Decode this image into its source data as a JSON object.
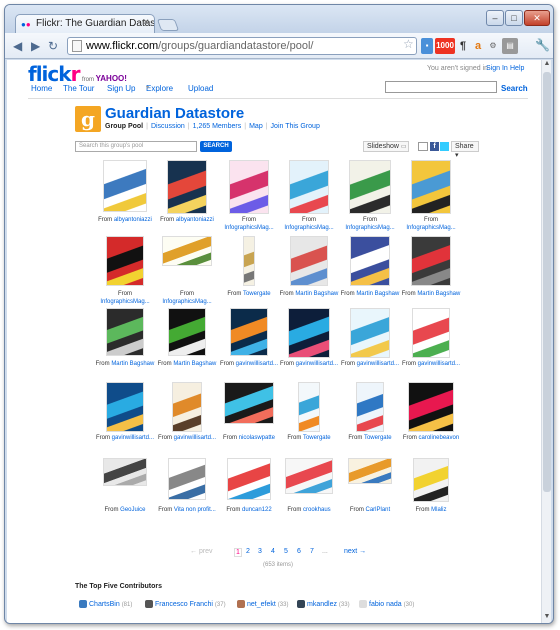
{
  "browser": {
    "tab_title": "Flickr: The Guardian Datastore",
    "url_host": "www.flickr.com",
    "url_path": "/groups/guardiandatastore/pool/",
    "ext_counter": "1000"
  },
  "header": {
    "logo_part1": "flick",
    "logo_part2": "r",
    "yahoo_prefix": "from",
    "yahoo": "YAHOO!",
    "signin_status": "You aren't signed in",
    "signin": "Sign In",
    "help": "Help",
    "search_button": "Search"
  },
  "nav": {
    "home": "Home",
    "tour": "The Tour",
    "signup": "Sign Up",
    "explore": "Explore",
    "upload": "Upload"
  },
  "group": {
    "title": "Guardian Datastore",
    "pool": "Group Pool",
    "discussion": "Discussion",
    "members": "1,265 Members",
    "map": "Map",
    "join": "Join This Group"
  },
  "pool_search": {
    "placeholder": "Search this group's pool",
    "button": "SEARCH"
  },
  "actions": {
    "slideshow": "Slideshow",
    "share": "Share"
  },
  "thumbs": [
    {
      "prefix": "From",
      "who": "albyantoniazzi",
      "colors": [
        "#ffffff",
        "#3d7abf",
        "#f0c93b"
      ]
    },
    {
      "prefix": "From",
      "who": "albyantoniazzi",
      "colors": [
        "#17324f",
        "#e4473a",
        "#f4d35e"
      ]
    },
    {
      "prefix": "From",
      "who": "InfographicsMag...",
      "colors": [
        "#fbe3ef",
        "#d6336c",
        "#6c5ce7"
      ]
    },
    {
      "prefix": "From",
      "who": "InfographicsMag...",
      "colors": [
        "#e3f2fb",
        "#3aa6d9",
        "#e8484f"
      ]
    },
    {
      "prefix": "From",
      "who": "InfographicsMag...",
      "colors": [
        "#f2f2e8",
        "#3a9a4a",
        "#2b2b2b"
      ]
    },
    {
      "prefix": "From",
      "who": "InfographicsMag...",
      "colors": [
        "#f3c63c",
        "#4a9ad4",
        "#222222"
      ]
    },
    {
      "prefix": "From",
      "who": "InfographicsMag...",
      "colors": [
        "#d42a2a",
        "#111111",
        "#f2d230"
      ]
    },
    {
      "prefix": "From",
      "who": "InfographicsMag...",
      "colors": [
        "#fdfdf3",
        "#e0a02a",
        "#5a8f3c"
      ]
    },
    {
      "prefix": "From",
      "who": "Towergate",
      "colors": [
        "#f5f1e3",
        "#c8a451",
        "#777777"
      ]
    },
    {
      "prefix": "From",
      "who": "Martin Bagshaw",
      "colors": [
        "#e7e7e7",
        "#d9534f",
        "#5e8fcf"
      ]
    },
    {
      "prefix": "From",
      "who": "Martin Bagshaw",
      "colors": [
        "#3b4f9e",
        "#ffffff",
        "#f5c046"
      ]
    },
    {
      "prefix": "From",
      "who": "Martin Bagshaw",
      "colors": [
        "#3a3a3a",
        "#e1333a",
        "#888888"
      ]
    },
    {
      "prefix": "From",
      "who": "Martin Bagshaw",
      "colors": [
        "#2b2b2b",
        "#5cb85c",
        "#cccccc"
      ]
    },
    {
      "prefix": "From",
      "who": "Martin Bagshaw",
      "colors": [
        "#111111",
        "#44aa33",
        "#eeeeee"
      ]
    },
    {
      "prefix": "From",
      "who": "gavinwillisartd...",
      "colors": [
        "#0b2b4a",
        "#f08a24",
        "#3fb1e6"
      ]
    },
    {
      "prefix": "From",
      "who": "gavinwillisartd...",
      "colors": [
        "#0d1e3a",
        "#29abe2",
        "#e94e77"
      ]
    },
    {
      "prefix": "From",
      "who": "gavinwillisartd...",
      "colors": [
        "#e9f6fc",
        "#3aa6d9",
        "#f2c94c"
      ]
    },
    {
      "prefix": "From",
      "who": "gavinwillisartd...",
      "colors": [
        "#ffffff",
        "#e8484f",
        "#4caf50"
      ]
    },
    {
      "prefix": "From",
      "who": "gavinwillisartd...",
      "colors": [
        "#0f4c8a",
        "#29abe2",
        "#f5c046"
      ]
    },
    {
      "prefix": "From",
      "who": "gavinwillisartd...",
      "colors": [
        "#f6efe0",
        "#e08a2a",
        "#5a3f2a"
      ]
    },
    {
      "prefix": "From",
      "who": "nicolaswpatte",
      "colors": [
        "#1a1a1a",
        "#3fc1e6",
        "#f26d5b"
      ]
    },
    {
      "prefix": "From",
      "who": "Towergate",
      "colors": [
        "#f3f8fb",
        "#3aa6d9",
        "#f08a24"
      ]
    },
    {
      "prefix": "From",
      "who": "Towergate",
      "colors": [
        "#eef5fb",
        "#2f78c4",
        "#e8484f"
      ]
    },
    {
      "prefix": "From",
      "who": "carolinebeavon",
      "colors": [
        "#111111",
        "#e8184f",
        "#f5c046"
      ]
    },
    {
      "prefix": "From",
      "who": "GeoJuice",
      "colors": [
        "#e8e8e8",
        "#444444",
        "#aaaaaa"
      ]
    },
    {
      "prefix": "From",
      "who": "Vita non profit...",
      "colors": [
        "#ffffff",
        "#888888",
        "#3a6ea5"
      ]
    },
    {
      "prefix": "From",
      "who": "duncan122",
      "colors": [
        "#ffffff",
        "#e84545",
        "#2d9cdb"
      ]
    },
    {
      "prefix": "From",
      "who": "crookhaus",
      "colors": [
        "#f7f7f7",
        "#e8484f",
        "#3fa3d9"
      ]
    },
    {
      "prefix": "From",
      "who": "CarlPlant",
      "colors": [
        "#f9f2e0",
        "#e89a2a",
        "#3a7abf"
      ]
    },
    {
      "prefix": "From",
      "who": "Mlaliz",
      "colors": [
        "#f2f2f2",
        "#f2d230",
        "#222222"
      ]
    }
  ],
  "pager": {
    "prev": "← prev",
    "pages": [
      "1",
      "2",
      "3",
      "4",
      "5",
      "6",
      "7"
    ],
    "dots": "...",
    "next": "next →",
    "count": "(653 items)"
  },
  "contributors": {
    "title": "The Top Five Contributors",
    "items": [
      {
        "name": "ChartsBin",
        "count": "(81)",
        "color": "#3a7abf"
      },
      {
        "name": "Francesco Franchi",
        "count": "(37)",
        "color": "#555555"
      },
      {
        "name": "net_efekt",
        "count": "(33)",
        "color": "#b07050"
      },
      {
        "name": "mkandlez",
        "count": "(33)",
        "color": "#334455"
      },
      {
        "name": "fabio nada",
        "count": "(30)",
        "color": "#dddddd"
      }
    ]
  }
}
